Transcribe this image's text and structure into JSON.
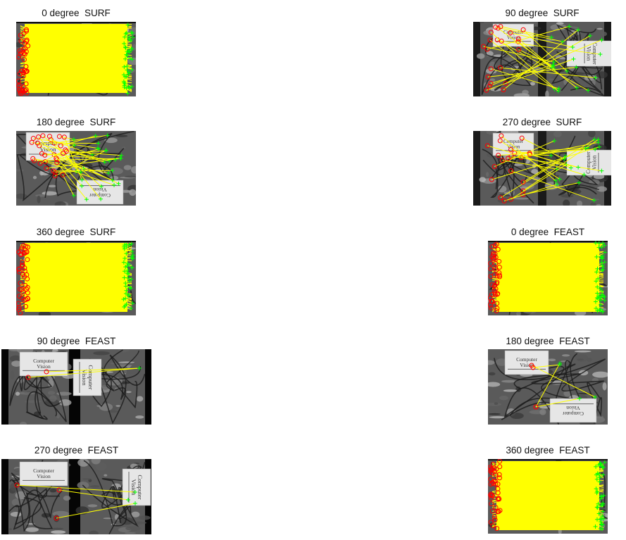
{
  "panels": [
    {
      "title": "0 degree  SURF",
      "variant": "dense"
    },
    {
      "title": "90 degree  SURF",
      "variant": "rot90"
    },
    {
      "title": "180 degree  SURF",
      "variant": "rot180"
    },
    {
      "title": "270 degree  SURF",
      "variant": "rot270"
    },
    {
      "title": "360 degree  SURF",
      "variant": "dense"
    },
    {
      "title": "0 degree  FEAST",
      "variant": "dense"
    },
    {
      "title": "90 degree  FEAST",
      "variant": "sparse90"
    },
    {
      "title": "180 degree  FEAST",
      "variant": "sparse180"
    },
    {
      "title": "270 degree  FEAST",
      "variant": "sparse270"
    },
    {
      "title": "360 degree  FEAST",
      "variant": "dense"
    }
  ],
  "book_text": {
    "line1": "Computer",
    "line2": "Vision"
  },
  "colors": {
    "match_line": "#ffff00",
    "point_a": "#ff0000",
    "point_b": "#00ff00",
    "figure_bg": "#ffffff"
  }
}
